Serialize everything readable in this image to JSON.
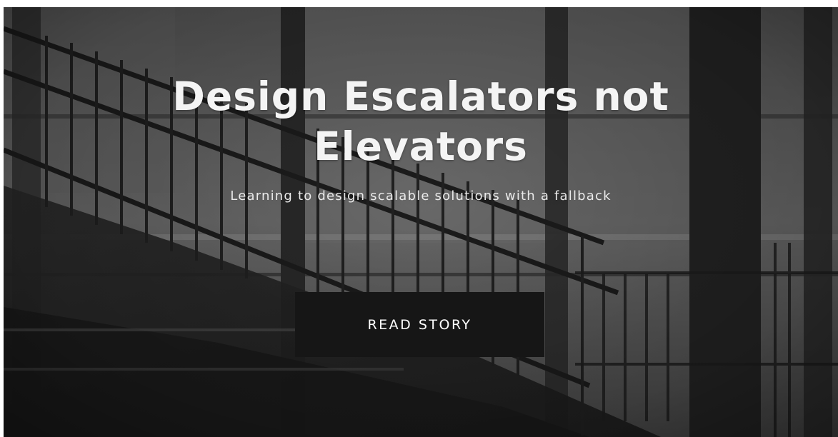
{
  "hero": {
    "title": "Design Escalators not Elevators",
    "subtitle": "Learning to design scalable solutions with a fallback",
    "cta_label": "READ STORY",
    "background_image": "stairway-railings-photo",
    "colors": {
      "button_bg": "#161616",
      "title_text": "#f4f4f4",
      "subtitle_text": "#eaeaea"
    }
  }
}
